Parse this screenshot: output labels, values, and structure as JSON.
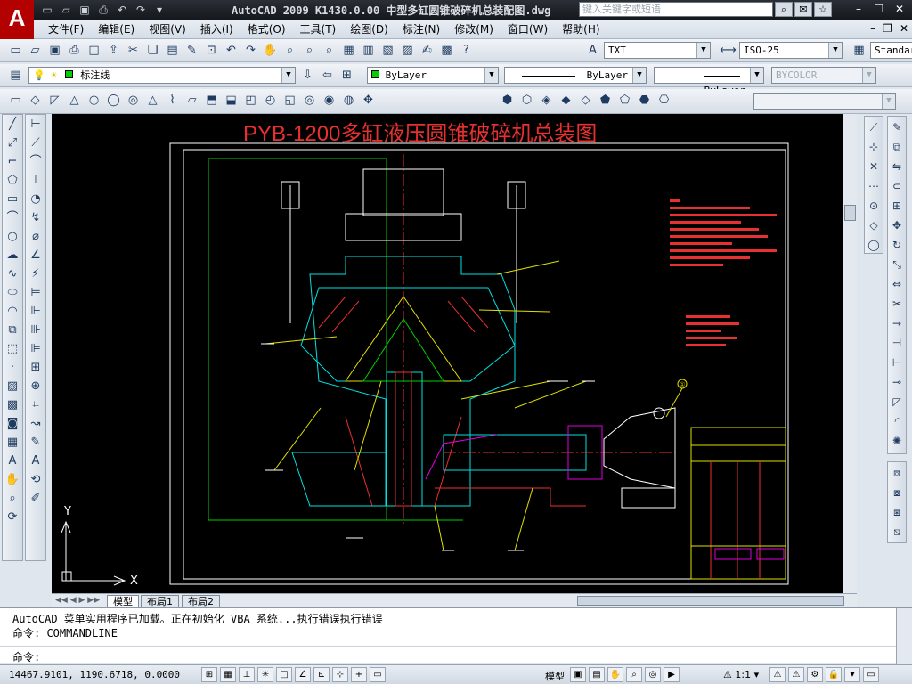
{
  "app": {
    "logo": "A",
    "title": "AutoCAD 2009  K1430.0.00 中型多缸圆锥破碎机总装配图.dwg",
    "help_search_placeholder": "键入关键字或短语"
  },
  "menu": [
    "文件(F)",
    "编辑(E)",
    "视图(V)",
    "插入(I)",
    "格式(O)",
    "工具(T)",
    "绘图(D)",
    "标注(N)",
    "修改(M)",
    "窗口(W)",
    "帮助(H)"
  ],
  "styles": {
    "text_style": "TXT",
    "dim_style": "ISO-25",
    "table_style": "Standar"
  },
  "layers": {
    "current_layer": "标注线",
    "color": "ByLayer",
    "linetype": "ByLayer",
    "lineweight": "ByLayer",
    "plot_style": "BYCOLOR"
  },
  "drawing": {
    "title": "PYB-1200多缸液压圆锥破碎机总装图",
    "ucs_x": "X",
    "ucs_y": "Y",
    "balloon": "①"
  },
  "tabs": [
    "模型",
    "布局1",
    "布局2"
  ],
  "command": {
    "line1": "AutoCAD 菜单实用程序已加载。正在初始化 VBA 系统...执行错误执行错误",
    "line2": "命令: COMMANDLINE",
    "prompt": "命令:"
  },
  "status": {
    "coords": "14467.9101, 1190.6718, 0.0000",
    "model_label": "模型",
    "scale": "1:1"
  },
  "colors": {
    "accent": "#b30000",
    "canvas": "#000000"
  }
}
